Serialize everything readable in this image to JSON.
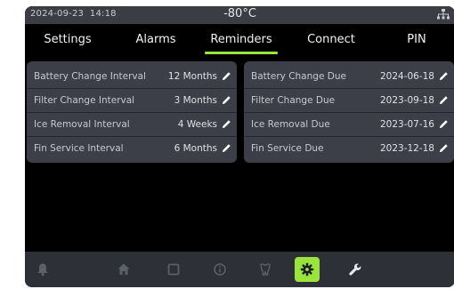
{
  "status": {
    "date": "2024-09-23",
    "time": "14:18",
    "temperature": "-80°C",
    "network_icon": "network-icon"
  },
  "tabs": [
    {
      "label": "Settings"
    },
    {
      "label": "Alarms"
    },
    {
      "label": "Reminders",
      "active": true
    },
    {
      "label": "Connect"
    },
    {
      "label": "PIN"
    }
  ],
  "intervals": [
    {
      "label": "Battery Change Interval",
      "value": "12 Months"
    },
    {
      "label": "Filter Change Interval",
      "value": "3 Months"
    },
    {
      "label": "Ice Removal Interval",
      "value": "4 Weeks"
    },
    {
      "label": "Fin Service Interval",
      "value": "6 Months"
    }
  ],
  "due_dates": [
    {
      "label": "Battery Change Due",
      "value": "2024-06-18"
    },
    {
      "label": "Filter Change Due",
      "value": "2023-09-18"
    },
    {
      "label": "Ice Removal Due",
      "value": "2023-07-16"
    },
    {
      "label": "Fin Service Due",
      "value": "2023-12-18"
    }
  ],
  "nav": [
    {
      "icon": "bell-icon"
    },
    {
      "icon": "home-icon"
    },
    {
      "icon": "square-icon"
    },
    {
      "icon": "info-icon"
    },
    {
      "icon": "tooth-icon"
    },
    {
      "icon": "gear-icon",
      "active": true
    },
    {
      "icon": "wrench-icon"
    }
  ],
  "colors": {
    "accent": "#9be33f",
    "panel": "#3c3f47",
    "statusbar": "#3a3d44",
    "navbar": "#2d3036"
  }
}
